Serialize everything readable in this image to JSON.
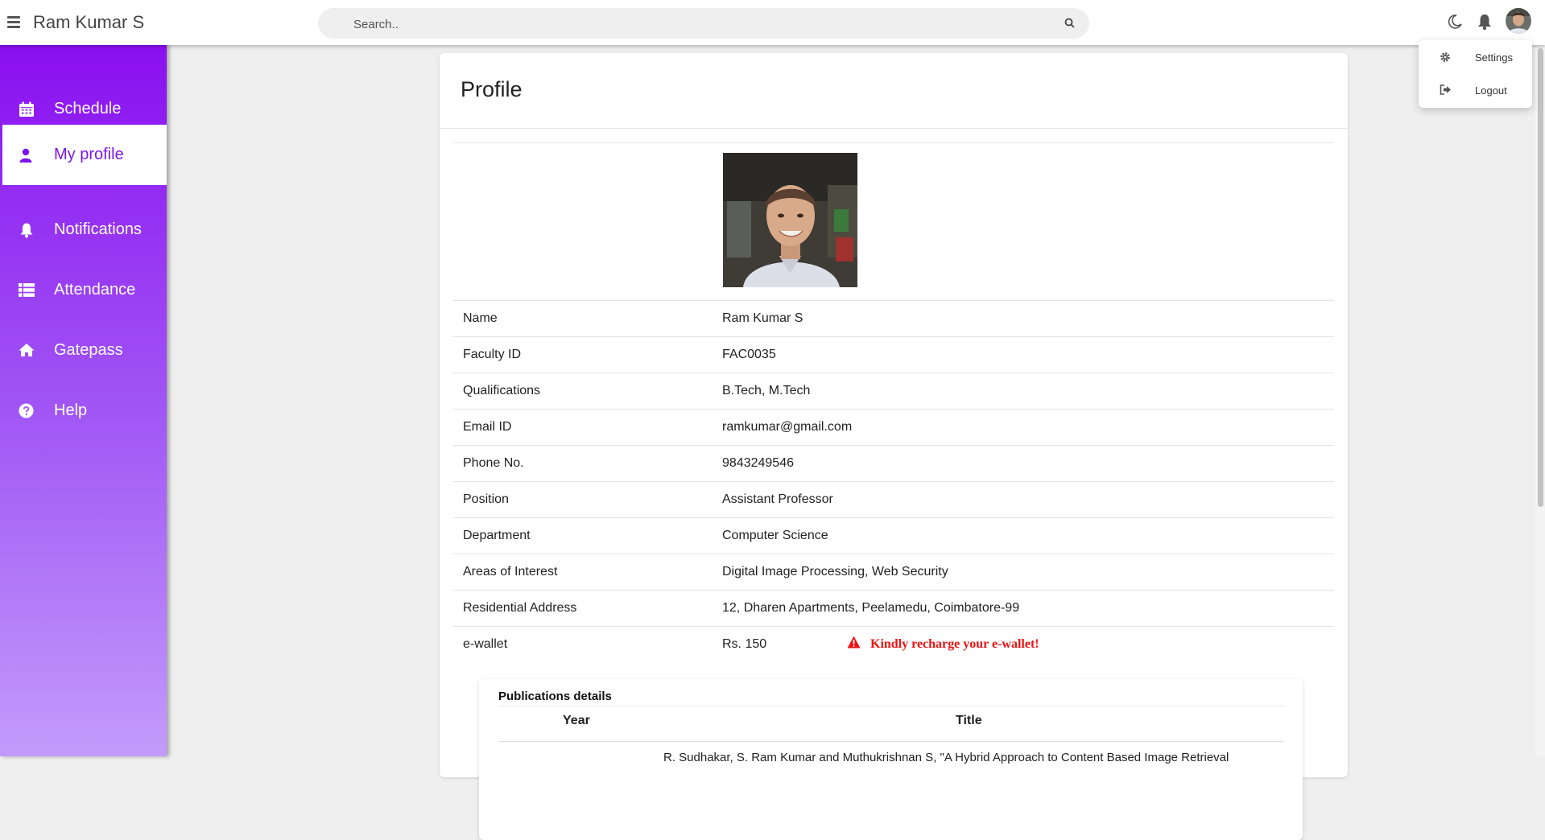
{
  "header": {
    "title": "Ram Kumar S",
    "search_placeholder": "Search.."
  },
  "user_menu": {
    "items": [
      {
        "label": "Settings",
        "icon": "gear-icon"
      },
      {
        "label": "Logout",
        "icon": "logout-icon"
      }
    ]
  },
  "sidebar": {
    "items": [
      {
        "label": "Schedule",
        "icon": "calendar-icon",
        "active": false
      },
      {
        "label": "My profile",
        "icon": "user-icon",
        "active": true
      },
      {
        "label": "Notifications",
        "icon": "bell-icon",
        "active": false
      },
      {
        "label": "Attendance",
        "icon": "list-icon",
        "active": false
      },
      {
        "label": "Gatepass",
        "icon": "home-icon",
        "active": false
      },
      {
        "label": "Help",
        "icon": "question-circle-icon",
        "active": false
      }
    ]
  },
  "profile": {
    "title": "Profile",
    "fields": [
      {
        "label": "Name",
        "value": "Ram Kumar S"
      },
      {
        "label": "Faculty ID",
        "value": "FAC0035"
      },
      {
        "label": "Qualifications",
        "value": "B.Tech, M.Tech"
      },
      {
        "label": "Email ID",
        "value": "ramkumar@gmail.com"
      },
      {
        "label": "Phone No.",
        "value": "9843249546"
      },
      {
        "label": "Position",
        "value": "Assistant Professor"
      },
      {
        "label": "Department",
        "value": "Computer Science"
      },
      {
        "label": "Areas of Interest",
        "value": "Digital Image Processing, Web Security"
      },
      {
        "label": "Residential Address",
        "value": "12, Dharen Apartments, Peelamedu, Coimbatore-99"
      },
      {
        "label": "e-wallet",
        "value": "Rs. 150"
      }
    ],
    "wallet_warning": "Kindly recharge your e-wallet!"
  },
  "publications": {
    "title": "Publications details",
    "columns": [
      "Year",
      "Title"
    ],
    "first_row_partial": "R. Sudhakar, S. Ram Kumar and Muthukrishnan S, \"A Hybrid Approach to Content Based Image Retrieval"
  },
  "colors": {
    "sidebar_top": "#8a0ff0",
    "sidebar_bottom": "#c39bfb",
    "active_text": "#7b16ee",
    "warning": "#ee1111"
  }
}
